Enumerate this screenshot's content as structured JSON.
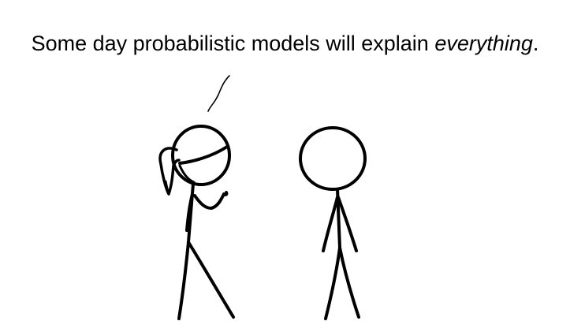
{
  "caption": {
    "text_before": "Some day probabilistic models will explain ",
    "emphasis": "everything",
    "text_after": "."
  },
  "figures": [
    {
      "role": "speaker",
      "hair": "ponytail",
      "icon": "stick-figure-woman"
    },
    {
      "role": "listener",
      "hair": "none",
      "icon": "stick-figure-man"
    }
  ],
  "colors": {
    "background": "#ffffff",
    "ink": "#000000"
  }
}
